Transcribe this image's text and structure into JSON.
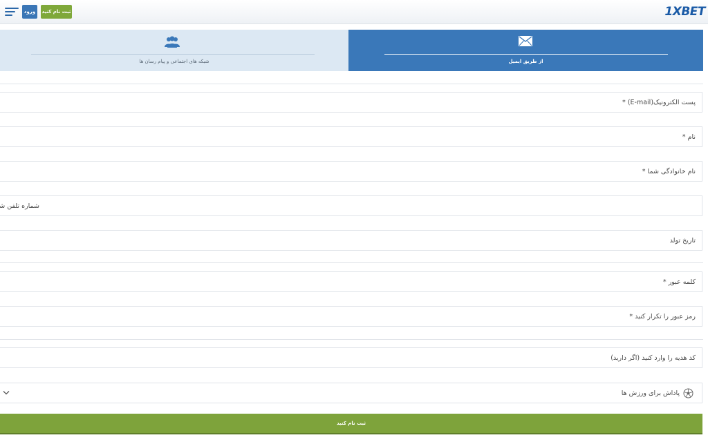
{
  "header": {
    "logo_text": "1XBET",
    "login_label": "ورود",
    "register_label": "ثبت نام کنید",
    "menu_icon": "hamburger-icon"
  },
  "tabs": [
    {
      "label": "شبکه های اجتماعی و پیام رسان ها",
      "icon": "users-icon",
      "active": false
    },
    {
      "label": "از طریق ایمیل",
      "icon": "envelope-icon",
      "active": true
    }
  ],
  "form": {
    "email_label": "پست الکترونیک(E-mail) *",
    "first_name_label": "نام *",
    "last_name_label": "نام خانوادگی شما *",
    "phone_label": "شماره تلفن شما",
    "birth_date_label": "تاریخ تولد",
    "password_label": "کلمه عبور *",
    "repeat_password_label": "رمز عبور را تکرار کنید *",
    "promo_label": "کد هدیه را وارد کنید (اگر دارید)",
    "bonus_label": "پاداش برای ورزش ها",
    "bonus_icon": "soccer-ball-icon",
    "submit_label": "ثبت نام کنید"
  },
  "colors": {
    "brand_blue": "#3a78b9",
    "accent_green": "#7ea33b",
    "logo_blue": "#1a5aa6"
  }
}
